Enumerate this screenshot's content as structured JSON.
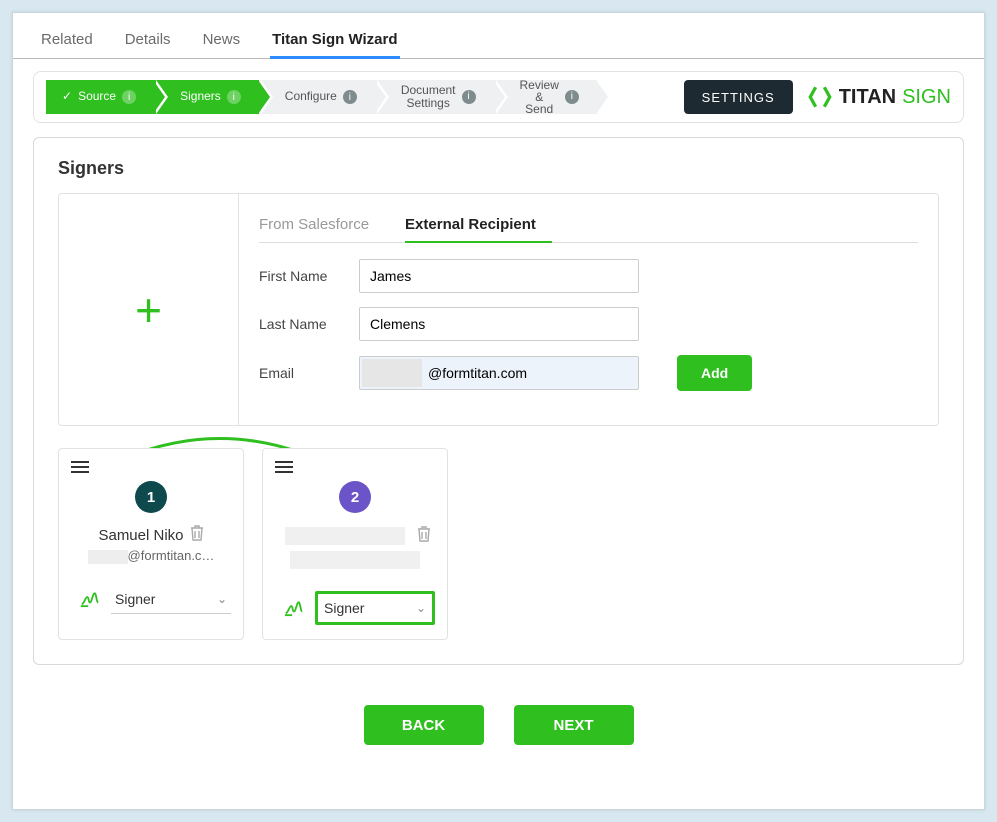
{
  "topTabs": {
    "related": "Related",
    "details": "Details",
    "news": "News",
    "wizard": "Titan Sign Wizard"
  },
  "steps": {
    "source": "Source",
    "signers": "Signers",
    "configure": "Configure",
    "docSettings": "Document Settings",
    "review": "Review & Send"
  },
  "settingsLabel": "SETTINGS",
  "brand": {
    "main": "TITAN",
    "accent": "SIGN"
  },
  "panelTitle": "Signers",
  "subTabs": {
    "sf": "From Salesforce",
    "ext": "External Recipient"
  },
  "form": {
    "firstNameLabel": "First Name",
    "firstNameValue": "James",
    "lastNameLabel": "Last Name",
    "lastNameValue": "Clemens",
    "emailLabel": "Email",
    "emailValue": "@formtitan.com",
    "addLabel": "Add"
  },
  "signers": [
    {
      "num": "1",
      "name": "Samuel Niko",
      "email": "@formtitan.c…",
      "role": "Signer"
    },
    {
      "num": "2",
      "name": "",
      "email": "",
      "role": "Signer"
    }
  ],
  "nav": {
    "back": "BACK",
    "next": "NEXT"
  }
}
